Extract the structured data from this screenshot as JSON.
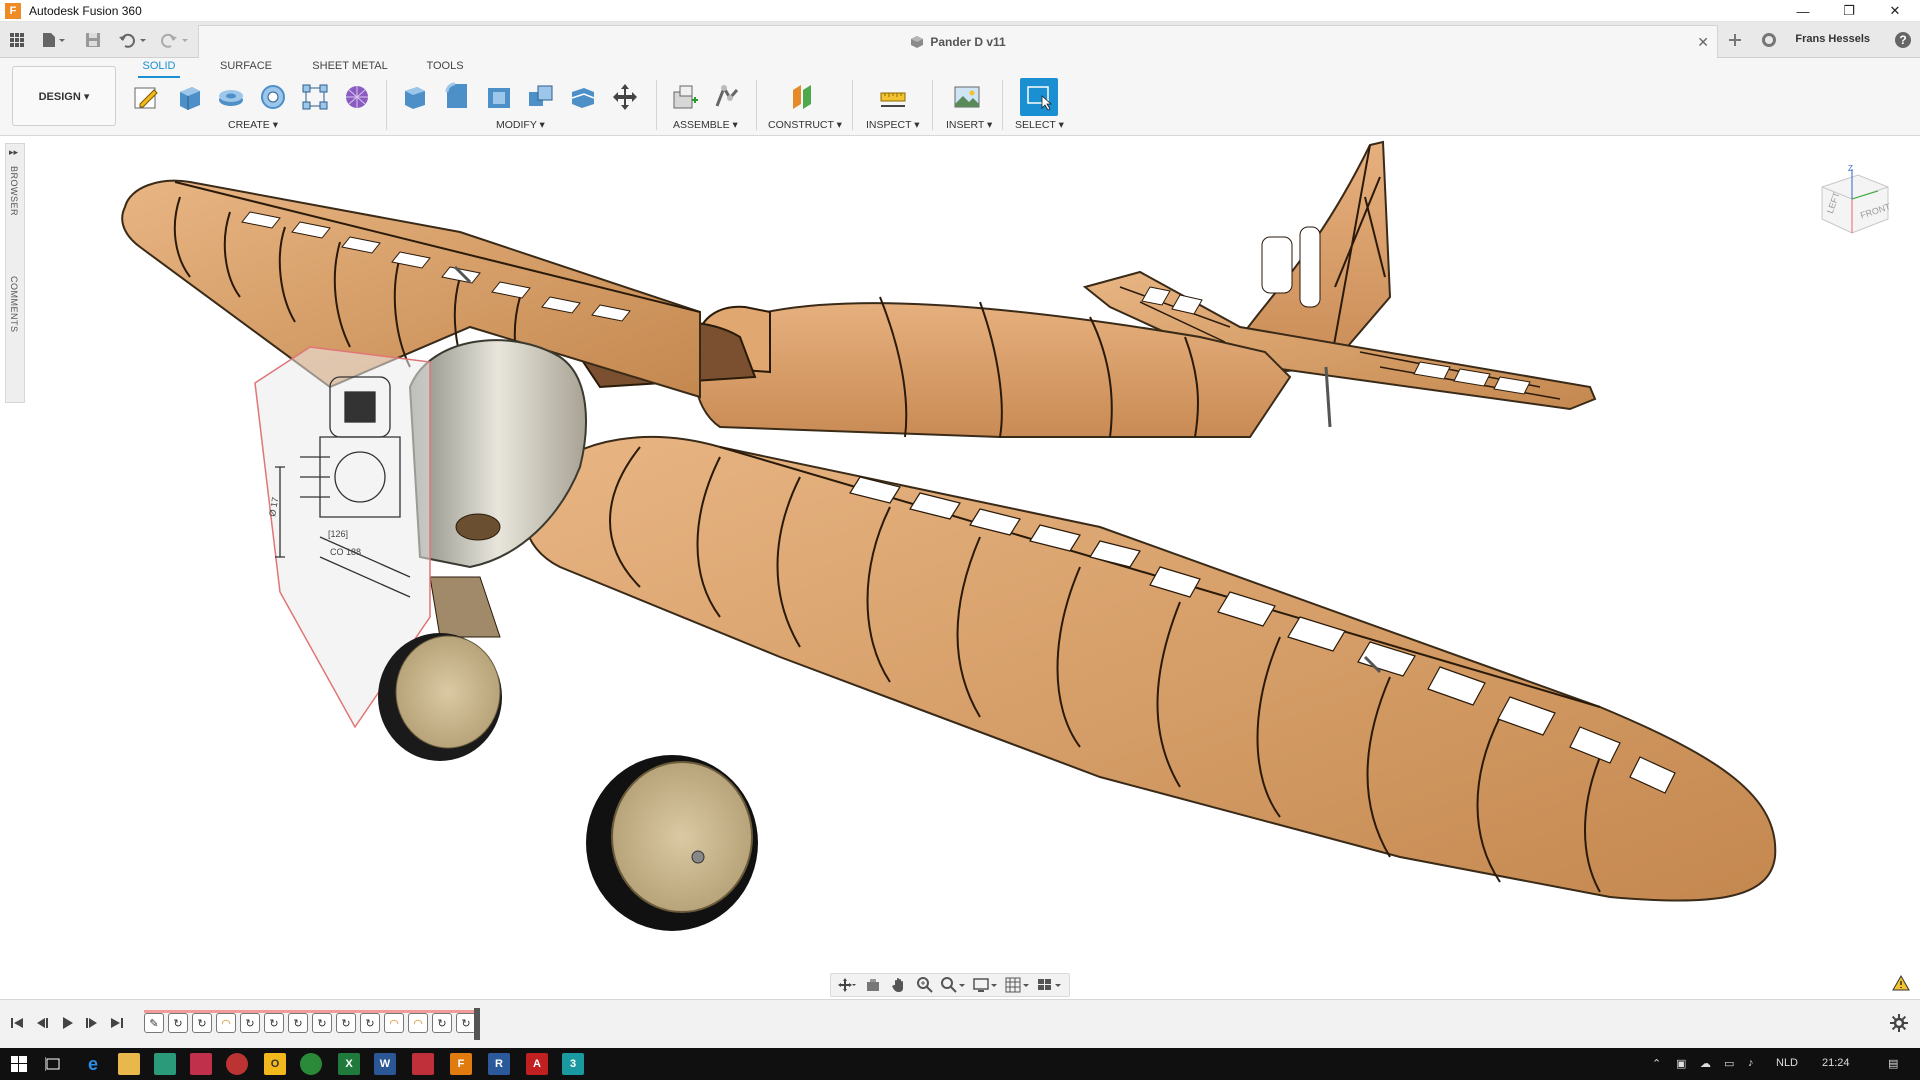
{
  "app": {
    "title": "Autodesk Fusion 360",
    "icon_letter": "F"
  },
  "window_controls": {
    "minimize": "—",
    "restore": "❐",
    "close": "✕"
  },
  "document": {
    "name": "Pander D v11"
  },
  "user": {
    "name": "Frans Hessels"
  },
  "workspace": {
    "label": "DESIGN ▾"
  },
  "ribbon_tabs": [
    {
      "label": "SOLID",
      "active": true
    },
    {
      "label": "SURFACE",
      "active": false
    },
    {
      "label": "SHEET METAL",
      "active": false
    },
    {
      "label": "TOOLS",
      "active": false
    }
  ],
  "ribbon_groups": [
    {
      "label": "CREATE ▾",
      "tools": [
        "sketch-icon",
        "extrude-icon",
        "revolve-icon",
        "hole-icon",
        "pattern-icon",
        "form-icon"
      ]
    },
    {
      "label": "MODIFY ▾",
      "tools": [
        "press-pull-icon",
        "fillet-icon",
        "shell-icon",
        "combine-icon",
        "split-body-icon",
        "move-icon"
      ]
    },
    {
      "label": "ASSEMBLE ▾",
      "tools": [
        "new-component-icon",
        "joint-icon"
      ]
    },
    {
      "label": "CONSTRUCT ▾",
      "tools": [
        "offset-plane-icon"
      ]
    },
    {
      "label": "INSPECT ▾",
      "tools": [
        "measure-icon"
      ]
    },
    {
      "label": "INSERT ▾",
      "tools": [
        "insert-image-icon"
      ]
    },
    {
      "label": "SELECT ▾",
      "tools": [
        "select-icon"
      ]
    }
  ],
  "side_panel": {
    "browser": "BROWSER",
    "comments": "COMMENTS"
  },
  "viewcube": {
    "left": "LEFT",
    "front": "FRONT",
    "z_axis": "Z"
  },
  "navbar": [
    "orbit-icon",
    "look-at-icon",
    "pan-icon",
    "zoom-icon",
    "fit-icon",
    "display-settings-icon",
    "grid-icon",
    "viewports-icon"
  ],
  "timeline": {
    "features": [
      {
        "icon": "sketch",
        "glyph": "✎",
        "color": "normal"
      },
      {
        "icon": "revolve",
        "glyph": "↻",
        "color": "normal"
      },
      {
        "icon": "revolve",
        "glyph": "↻",
        "color": "normal"
      },
      {
        "icon": "fillet",
        "glyph": "◠",
        "color": "orange"
      },
      {
        "icon": "revolve",
        "glyph": "↻",
        "color": "normal"
      },
      {
        "icon": "revolve",
        "glyph": "↻",
        "color": "normal"
      },
      {
        "icon": "revolve",
        "glyph": "↻",
        "color": "normal"
      },
      {
        "icon": "revolve",
        "glyph": "↻",
        "color": "normal"
      },
      {
        "icon": "revolve",
        "glyph": "↻",
        "color": "normal"
      },
      {
        "icon": "revolve",
        "glyph": "↻",
        "color": "normal"
      },
      {
        "icon": "fillet",
        "glyph": "◠",
        "color": "orange"
      },
      {
        "icon": "fillet",
        "glyph": "◠",
        "color": "orange"
      },
      {
        "icon": "revolve",
        "glyph": "↻",
        "color": "normal"
      },
      {
        "icon": "revolve",
        "glyph": "↻",
        "color": "normal"
      }
    ]
  },
  "taskbar": {
    "language": "NLD",
    "time": "21:24",
    "apps": [
      "start",
      "task-view",
      "edge",
      "file-explorer",
      "sketchup",
      "app-red",
      "app-chrome-like",
      "powerpoint-yellow",
      "chrome",
      "excel",
      "word",
      "app-red-2",
      "fusion360",
      "revit",
      "autocad",
      "3ds"
    ]
  },
  "colors": {
    "accent": "#1a8fd1",
    "wood": "#d9a06b",
    "wood_dark": "#b57b47",
    "taskbar": "#101010"
  }
}
